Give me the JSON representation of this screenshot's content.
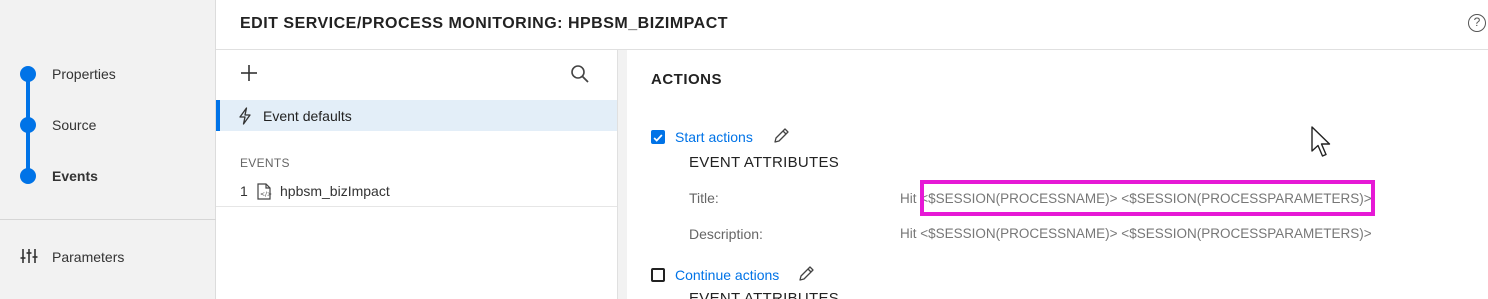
{
  "header": {
    "title": "EDIT SERVICE/PROCESS MONITORING: HPBSM_BIZIMPACT",
    "help_icon": "help-circle-icon"
  },
  "wizard": {
    "steps": [
      {
        "label": "Properties",
        "active": false
      },
      {
        "label": "Source",
        "active": false
      },
      {
        "label": "Events",
        "active": true
      }
    ],
    "parameters_label": "Parameters",
    "accent": "#0073e7"
  },
  "list_pane": {
    "add_icon": "plus-icon",
    "search_icon": "search-icon",
    "event_defaults_label": "Event defaults",
    "events_header": "EVENTS",
    "events": [
      {
        "number": "1",
        "name": "hpbsm_bizImpact"
      }
    ]
  },
  "actions": {
    "title": "ACTIONS",
    "start": {
      "label": "Start actions",
      "checked": true,
      "section_title": "EVENT ATTRIBUTES",
      "title_label": "Title:",
      "title_value": "Hit <$SESSION(PROCESSNAME)> <$SESSION(PROCESSPARAMETERS)>",
      "description_label": "Description:",
      "description_value": "Hit <$SESSION(PROCESSNAME)> <$SESSION(PROCESSPARAMETERS)>"
    },
    "continue": {
      "label": "Continue actions",
      "checked": false,
      "section_title": "EVENT ATTRIBUTES"
    }
  },
  "highlight_color": "#e619d6"
}
